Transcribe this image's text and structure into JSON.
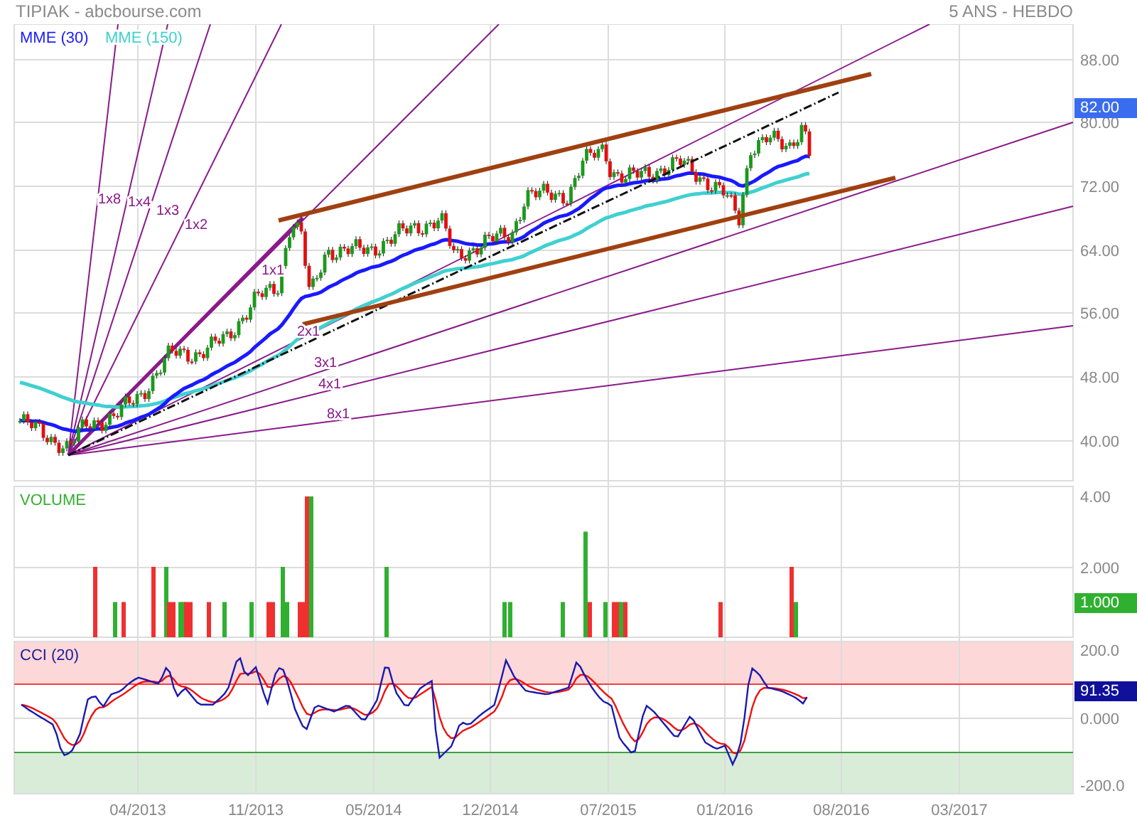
{
  "header": {
    "title": "TIPIAK - abcbourse.com",
    "period": "5 ANS - HEBDO"
  },
  "legend": [
    {
      "label": "MME (30)",
      "color": "#1a1aff"
    },
    {
      "label": "MME (150)",
      "color": "#40d0d0"
    }
  ],
  "price_axis": [
    "88.00",
    "80.00",
    "72.00",
    "64.00",
    "56.00",
    "48.00",
    "40.00"
  ],
  "last_price": "82.00",
  "fan_labels": [
    "1x8",
    "1x4",
    "1x3",
    "1x2",
    "1x1",
    "2x1",
    "3x1",
    "4x1",
    "8x1"
  ],
  "volume": {
    "title": "VOLUME",
    "ticks": [
      "4.00",
      "2.000"
    ],
    "last": "1.000"
  },
  "cci": {
    "title": "CCI (20)",
    "ticks": [
      "200.0",
      "0.000",
      "-200.0"
    ],
    "last": "91.35"
  },
  "x_axis": [
    "04/2013",
    "11/2013",
    "05/2014",
    "12/2014",
    "07/2015",
    "01/2016",
    "08/2016",
    "03/2017"
  ]
}
